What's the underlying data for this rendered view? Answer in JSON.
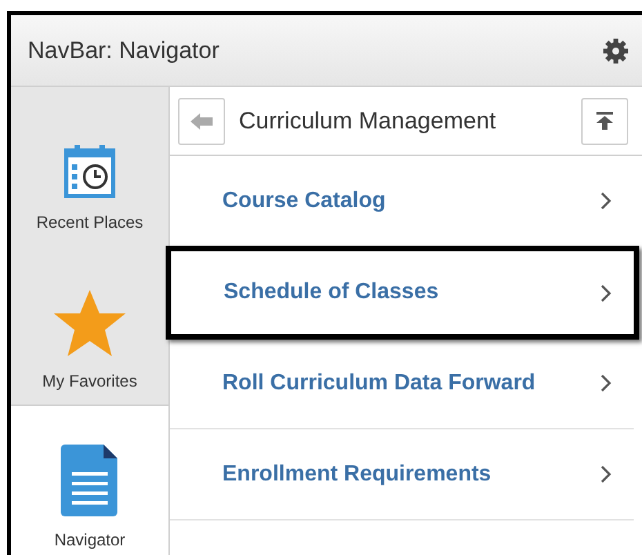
{
  "window": {
    "title": "NavBar: Navigator"
  },
  "sidebar": {
    "items": [
      {
        "label": "Recent Places",
        "kind": "calendar",
        "selected": false
      },
      {
        "label": "My Favorites",
        "kind": "star",
        "selected": false
      },
      {
        "label": "Navigator",
        "kind": "document",
        "selected": true
      }
    ]
  },
  "panel": {
    "title": "Curriculum Management",
    "items": [
      {
        "label": "Course Catalog",
        "highlighted": false
      },
      {
        "label": "Schedule of Classes",
        "highlighted": true
      },
      {
        "label": "Roll Curriculum Data Forward",
        "highlighted": false
      },
      {
        "label": "Enrollment Requirements",
        "highlighted": false
      }
    ]
  }
}
